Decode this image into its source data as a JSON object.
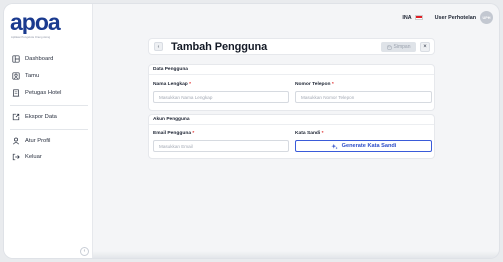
{
  "brand": {
    "logo_text": "apoa",
    "tagline": "Aplikasi Pengelola Orang Asing",
    "accent_color": "#1a3a8f"
  },
  "sidebar": {
    "items": [
      {
        "label": "Dashboard",
        "icon": "dashboard-icon"
      },
      {
        "label": "Tamu",
        "icon": "guest-icon"
      },
      {
        "label": "Petugas Hotel",
        "icon": "building-icon"
      },
      {
        "label": "Ekspor Data",
        "icon": "export-icon"
      },
      {
        "label": "Atur Profil",
        "icon": "user-icon"
      },
      {
        "label": "Keluar",
        "icon": "logout-icon"
      }
    ],
    "collapse_icon": "chevron-left-icon"
  },
  "topbar": {
    "language": "INA",
    "user_name": "User Perhotelan",
    "avatar_initials": "UPH"
  },
  "page": {
    "title": "Tambah Pengguna",
    "save_label": "Simpan",
    "close_label": "×",
    "back_label": "‹"
  },
  "sections": {
    "data_pengguna": {
      "title": "Data Pengguna",
      "nama_label": "Nama Lengkap",
      "nama_placeholder": "Masukkan Nama Lengkap",
      "telepon_label": "Nomor Telepon",
      "telepon_placeholder": "Masukkan Nomor Telepon"
    },
    "akun_pengguna": {
      "title": "Akun Pengguna",
      "email_label": "Email Pengguna",
      "email_placeholder": "Masukkan Email",
      "sandi_label": "Kata Sandi",
      "generate_label": "Generate Kata Sandi"
    }
  },
  "required_mark": "*"
}
